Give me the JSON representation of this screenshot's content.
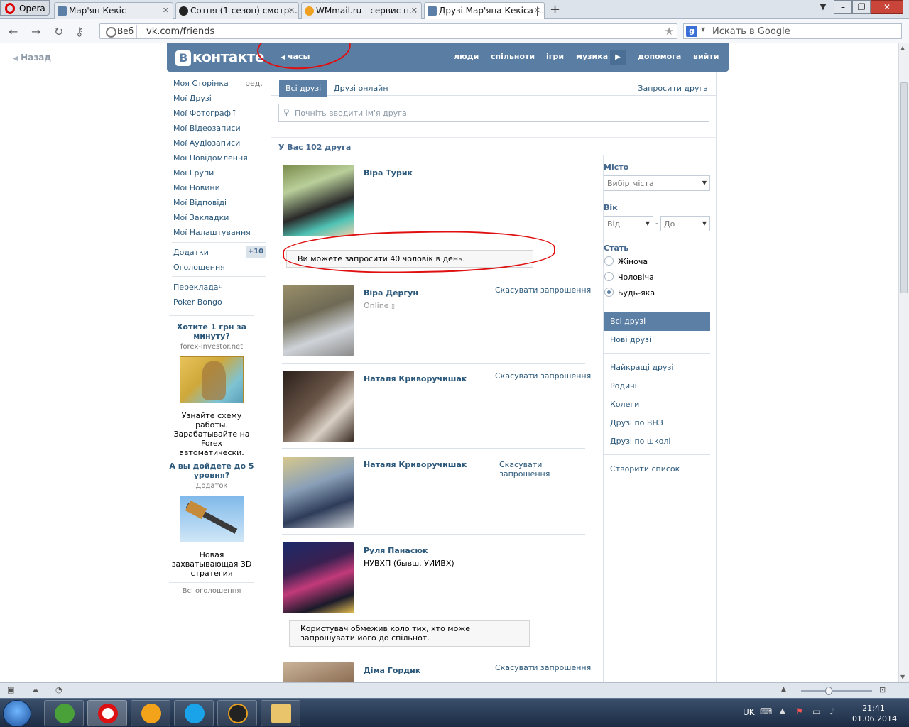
{
  "browser": {
    "menu_label": "Opera",
    "tabs": [
      {
        "label": "Мар'ян Кекіс",
        "icon": "vk-icon"
      },
      {
        "label": "Сотня (1 сезон) смотр...",
        "icon": "panda-icon"
      },
      {
        "label": "WMmail.ru - сервис п...",
        "icon": "wmmail-icon"
      },
      {
        "label": "Друзі Мар'яна Кекіса |...",
        "icon": "vk-icon"
      }
    ],
    "address": {
      "web_label": "Веб",
      "url": "vk.com/friends"
    },
    "search_placeholder": "Искать в Google"
  },
  "page": {
    "back_label": "Назад",
    "header": {
      "logo_text": "контакте",
      "logo_letter": "В",
      "audio_label": "часы",
      "nav": [
        "люди",
        "спільноти",
        "ігри",
        "музика",
        "допомога",
        "вийти"
      ]
    },
    "left_menu": {
      "items": [
        "Моя Сторінка",
        "Мої Друзі",
        "Мої Фотографії",
        "Мої Відеозаписи",
        "Мої Аудіозаписи",
        "Мої Повідомлення",
        "Мої Групи",
        "Мої Новини",
        "Мої Відповіді",
        "Мої Закладки",
        "Мої Налаштування"
      ],
      "edit_label": "ред.",
      "apps_label": "Додатки",
      "apps_badge": "+10",
      "ads_label": "Оголошення",
      "extra": [
        "Перекладач",
        "Poker Bongo"
      ],
      "ad1": {
        "title": "Хотите 1 грн за минуту?",
        "domain": "forex-investor.net",
        "text": "Узнайте схему работы. Зарабатывайте на Forex автоматически."
      },
      "ad2": {
        "title": "А вы дойдете до 5 уровня?",
        "domain": "Додаток",
        "text": "Новая захватывающая 3D стратегия"
      },
      "all_ads": "Всі оголошення"
    },
    "friends": {
      "tabs": [
        "Всі друзі",
        "Друзі онлайн"
      ],
      "invite_label": "Запросити друга",
      "search_placeholder": "Почніть вводити ім'я друга",
      "count_label": "У Вас 102 друга",
      "list": [
        {
          "name": "Віра Турик",
          "sub": "",
          "online": "",
          "action": ""
        },
        {
          "name": "Віра Дергун",
          "sub": "",
          "online": "Online",
          "action": "Скасувати запрошення"
        },
        {
          "name": "Наталя Криворучишак",
          "sub": "",
          "online": "",
          "action": "Скасувати запрошення"
        },
        {
          "name": "Наталя Криворучишак",
          "sub": "",
          "online": "",
          "action": "Скасувати запрошення"
        },
        {
          "name": "Руля Панасюк",
          "sub": "НУВХП (бывш. УИИВХ)",
          "online": "",
          "action": ""
        },
        {
          "name": "Діма Гордик",
          "sub": "",
          "online": "",
          "action": "Скасувати запрошення"
        }
      ],
      "notice_invite": "Ви можете запросити 40 чоловік в день.",
      "notice_restricted": "Користувач обмежив коло тих, хто може запрошувати його до спільнот."
    },
    "filters": {
      "city_label": "Місто",
      "city_select": "Вибір міста",
      "age_label": "Вік",
      "age_from": "Від",
      "age_dash": "-",
      "age_to": "До",
      "gender_label": "Стать",
      "gender_options": [
        "Жіноча",
        "Чоловіча",
        "Будь-яка"
      ],
      "gender_selected": "Будь-яка",
      "nav1": [
        "Всі друзі",
        "Нові друзі"
      ],
      "nav2": [
        "Найкращі друзі",
        "Родичі",
        "Колеги",
        "Друзі по ВНЗ",
        "Друзі по школі"
      ],
      "create_list": "Створити список"
    }
  },
  "taskbar": {
    "language": "UK",
    "time": "21:41",
    "date": "01.06.2014"
  },
  "colors": {
    "vk_header": "#597da3",
    "vk_link": "#2b587a",
    "annotation_red": "#e01010"
  }
}
